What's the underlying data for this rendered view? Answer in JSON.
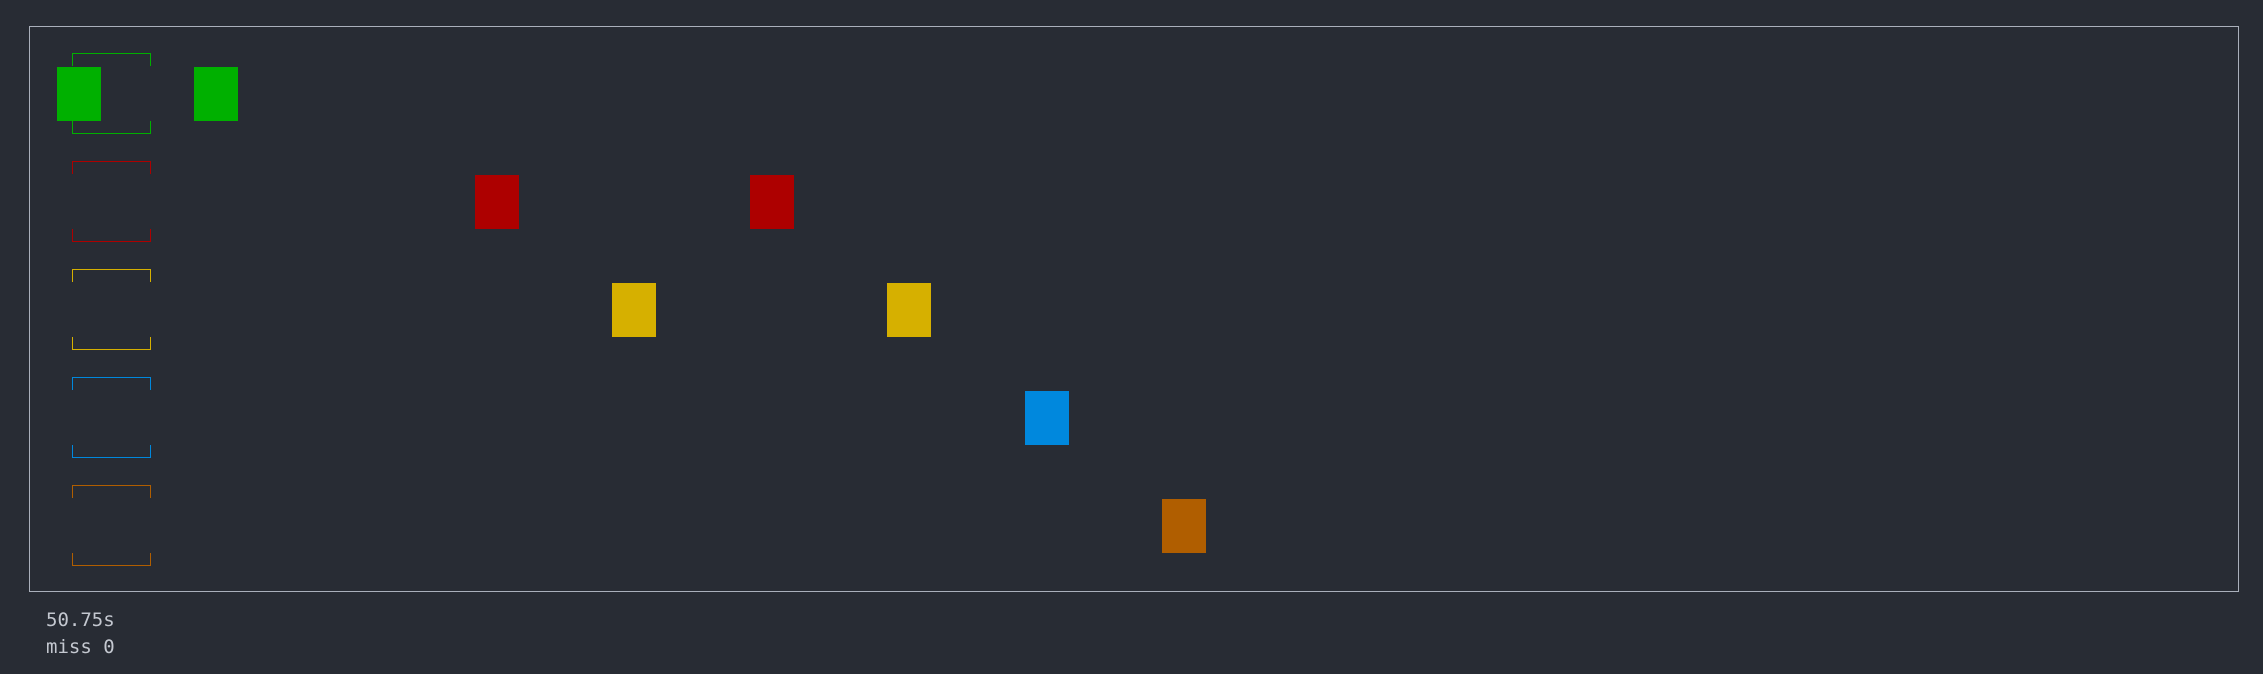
{
  "lane_colors": {
    "green": "#00b000",
    "red": "#ad0000",
    "yellow": "#d6b000",
    "blue": "#0088dd",
    "orange": "#b05e00"
  },
  "lanes": [
    "green",
    "red",
    "yellow",
    "blue",
    "orange"
  ],
  "notes": [
    {
      "lane": "green"
    },
    {
      "lane": "green"
    },
    {
      "lane": "red"
    },
    {
      "lane": "red"
    },
    {
      "lane": "yellow"
    },
    {
      "lane": "yellow"
    },
    {
      "lane": "blue"
    },
    {
      "lane": "orange"
    }
  ],
  "hud": {
    "time": "50.75s",
    "miss": "miss 0"
  }
}
